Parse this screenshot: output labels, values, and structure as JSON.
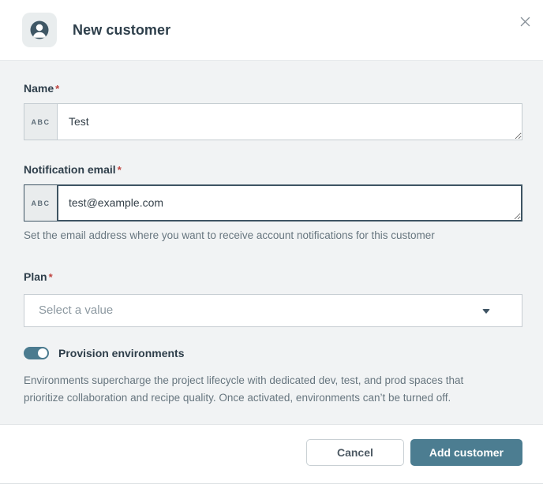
{
  "header": {
    "title": "New customer"
  },
  "form": {
    "name": {
      "label": "Name",
      "required_marker": "*",
      "prefix": "ABC",
      "value": "Test"
    },
    "email": {
      "label": "Notification email",
      "required_marker": "*",
      "prefix": "ABC",
      "value": "test@example.com",
      "helper": "Set the email address where you want to receive account notifications for this customer"
    },
    "plan": {
      "label": "Plan",
      "required_marker": "*",
      "placeholder": "Select a value"
    },
    "environments": {
      "label": "Provision environments",
      "toggle_state": "on",
      "description": "Environments supercharge the project lifecycle with dedicated dev, test, and prod spaces that prioritize collaboration and recipe quality. Once activated, environments can’t be turned off."
    }
  },
  "footer": {
    "cancel_label": "Cancel",
    "submit_label": "Add customer"
  },
  "icons": {
    "header": "user-avatar-icon",
    "close": "close-icon",
    "plan": "chevron-down-icon"
  },
  "colors": {
    "accent_teal": "#4c7d91",
    "required_red": "#bf4440",
    "body_background": "#f1f3f4",
    "focused_border": "#3e5463"
  }
}
